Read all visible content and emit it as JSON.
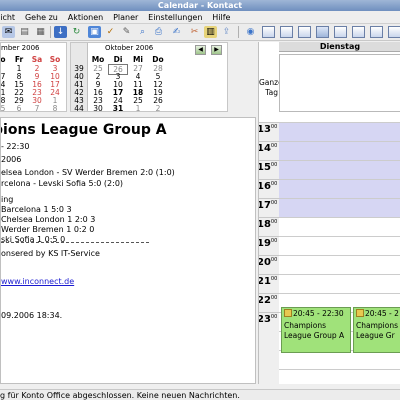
{
  "window": {
    "title": "Calendar - Kontact"
  },
  "menu": [
    "nsicht",
    "Gehe zu",
    "Aktionen",
    "Planer",
    "Einstellungen",
    "Hilfe"
  ],
  "minical_left": {
    "title": "mber 2006",
    "headers": [
      "o",
      "Fr",
      "Sa",
      "So"
    ],
    "rows": [
      [
        "",
        "1",
        "2",
        "3"
      ],
      [
        "7",
        "8",
        "9",
        "10"
      ],
      [
        "4",
        "15",
        "16",
        "17"
      ],
      [
        "1",
        "22",
        "23",
        "24"
      ],
      [
        "8",
        "29",
        "30",
        "1"
      ],
      [
        "5",
        "6",
        "7",
        "8"
      ]
    ]
  },
  "minical_right": {
    "title": "Oktober 2006",
    "headers": [
      "Mo",
      "Di",
      "Mi",
      "Do"
    ],
    "weeks": [
      "39",
      "40",
      "41",
      "42",
      "43",
      "44"
    ],
    "rows": [
      [
        "25",
        "26",
        "27",
        "28"
      ],
      [
        "2",
        "3",
        "4",
        "5"
      ],
      [
        "9",
        "10",
        "11",
        "12"
      ],
      [
        "16",
        "17",
        "18",
        "19"
      ],
      [
        "23",
        "24",
        "25",
        "26"
      ],
      [
        "30",
        "31",
        "1",
        "2"
      ]
    ]
  },
  "details": {
    "title": "pions League Group A",
    "time": "- 22:30",
    "date": "2006",
    "results": [
      "elsea London - SV Werder Bremen 2:0 (1:0)",
      "rcelona - Levski Sofia 5:0 (2:0)"
    ],
    "table_heading": "ing",
    "table": [
      "Barcelona 1 5:0 3",
      "Chelsea London 1 2:0 3",
      "Werder Bremen 1 0:2 0",
      "ski Sofia 1 0:5 0"
    ],
    "sponsor": "onsered by KS IT-Service",
    "link": "www.inconnect.de",
    "updated": "09.2006 18:34."
  },
  "agenda": {
    "day_header": "Dienstag",
    "allday_label": [
      "Ganzer",
      "Tag"
    ],
    "hours": [
      "13",
      "14",
      "15",
      "16",
      "17",
      "18",
      "19",
      "20",
      "21",
      "22",
      "23"
    ],
    "minutes_sup": "00",
    "events": [
      {
        "time": "20:45 - 22:30",
        "title": "Champions League Group A"
      },
      {
        "time": "20:45 - 2",
        "title": "Champions League Gr"
      }
    ]
  },
  "status": "g für Konto Office abgeschlossen. Keine neuen Nachrichten."
}
